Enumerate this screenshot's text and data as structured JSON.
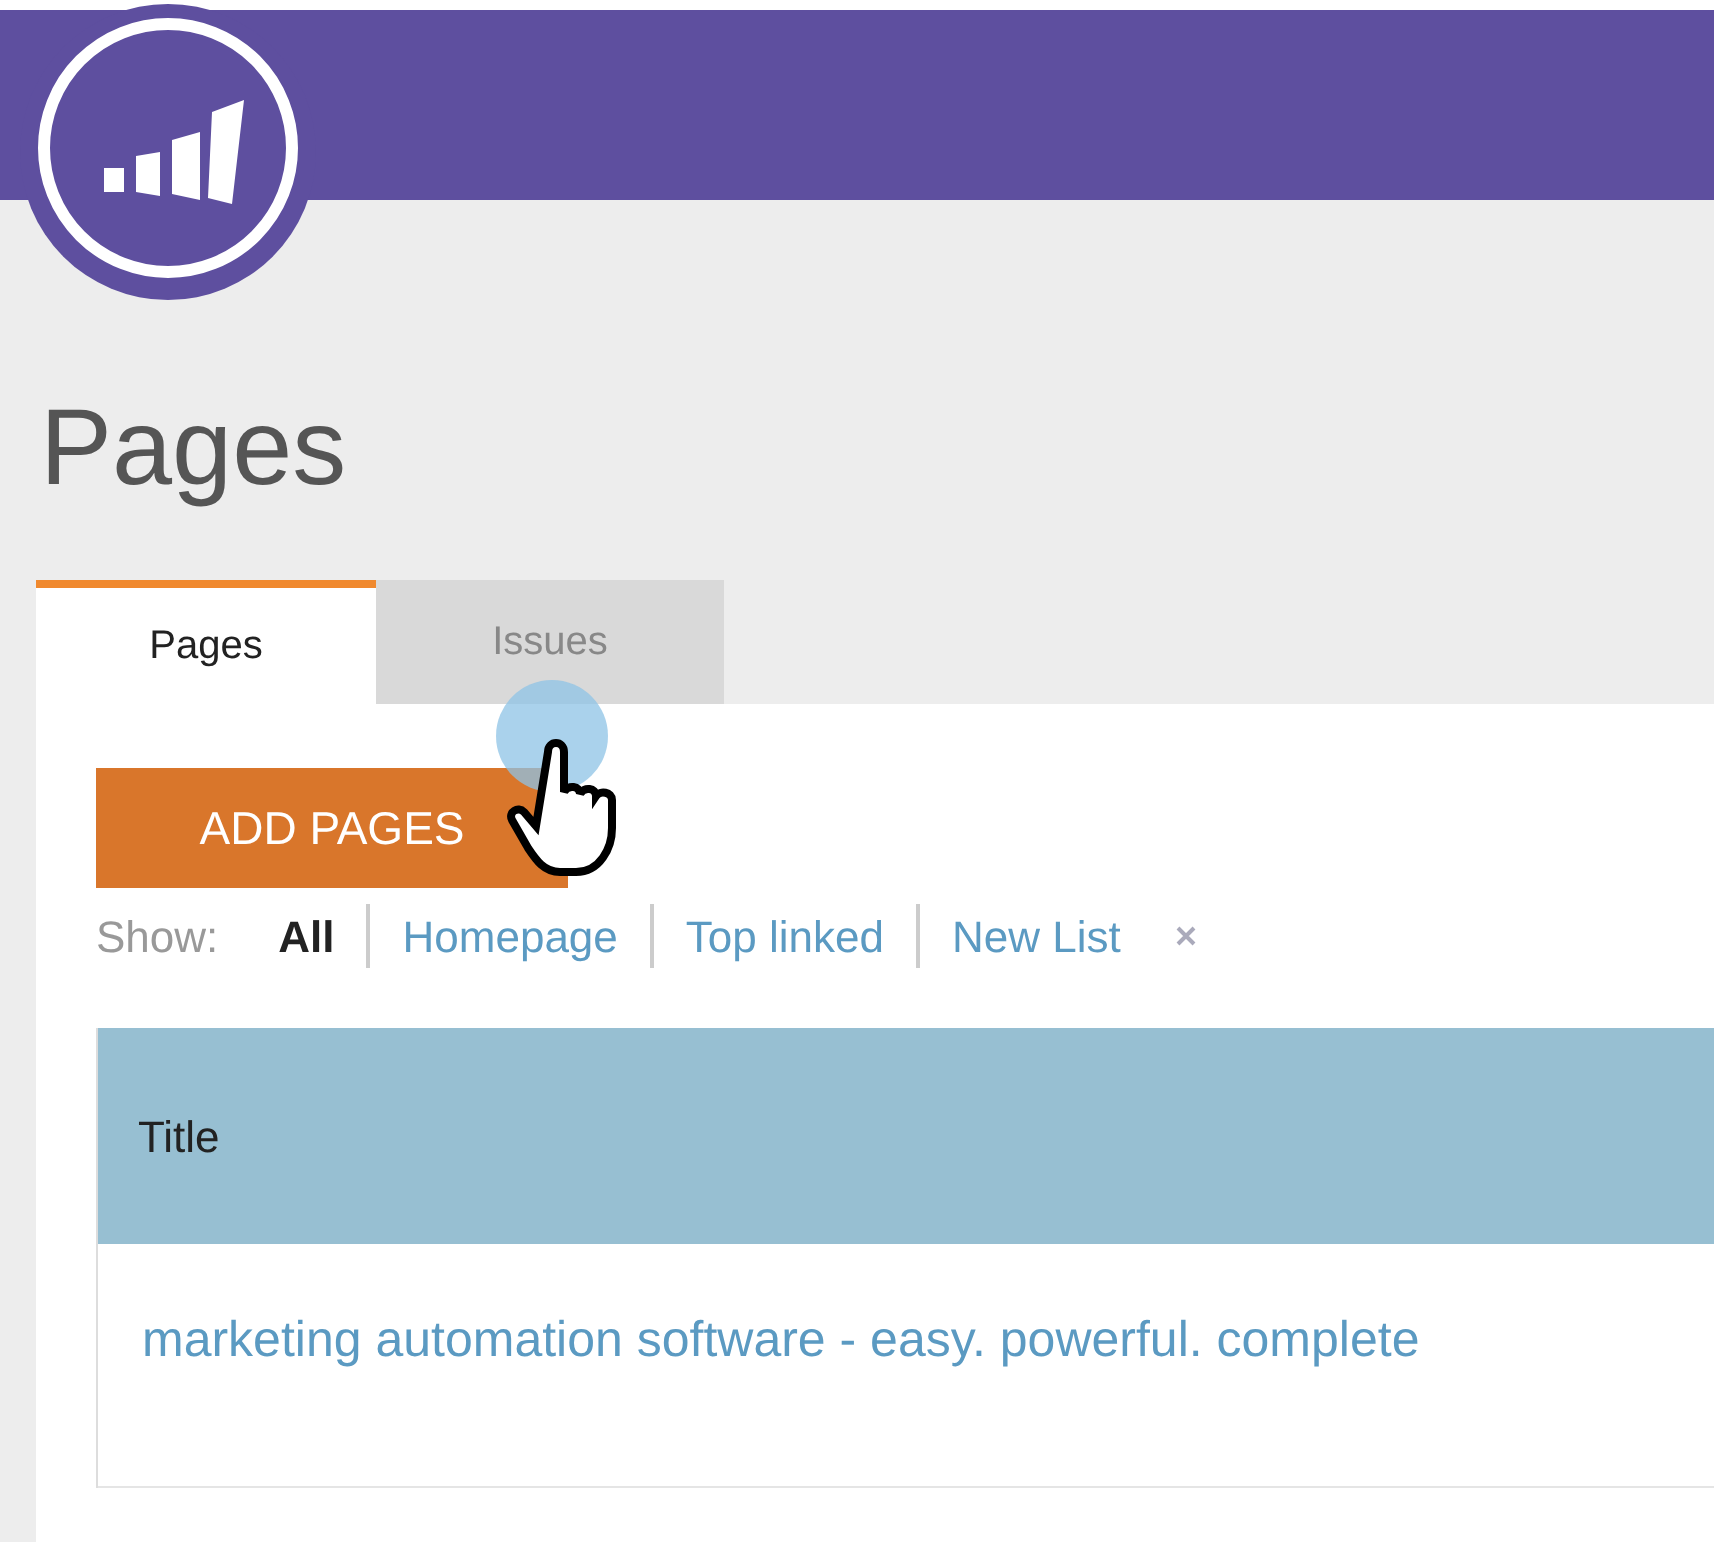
{
  "page_title": "Pages",
  "tabs": [
    {
      "label": "Pages",
      "selected": true
    },
    {
      "label": "Issues",
      "selected": false
    }
  ],
  "add_button": "ADD PAGES",
  "filter": {
    "label": "Show:",
    "options": [
      {
        "label": "All",
        "selected": true
      },
      {
        "label": "Homepage",
        "selected": false
      },
      {
        "label": "Top linked",
        "selected": false
      },
      {
        "label": "New List",
        "selected": false
      }
    ]
  },
  "table": {
    "columns": [
      "Title"
    ],
    "rows": [
      [
        "marketing automation software - easy. powerful. complete"
      ]
    ]
  }
}
